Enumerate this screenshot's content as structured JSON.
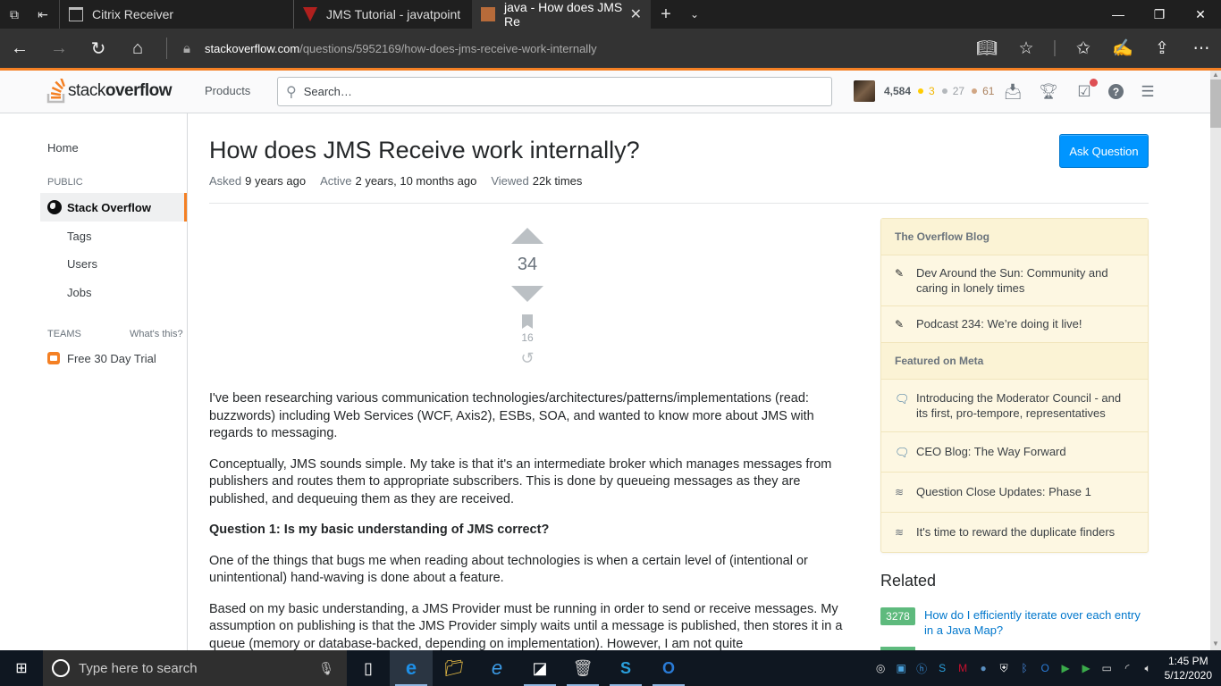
{
  "browser": {
    "tabs": [
      {
        "title": "Citrix Receiver",
        "icon": "window-icon",
        "active": false
      },
      {
        "title": "JMS Tutorial - javatpoint",
        "icon": "javatpoint-icon",
        "active": false
      },
      {
        "title": "java - How does JMS Re",
        "icon": "stackoverflow-icon",
        "active": true
      }
    ],
    "url_host": "stackoverflow.com",
    "url_path": "/questions/5952169/how-does-jms-receive-work-internally",
    "window_controls": {
      "minimize": "—",
      "restore": "❐",
      "close": "✕"
    }
  },
  "header": {
    "logo_light": "stack",
    "logo_bold": "overflow",
    "products": "Products",
    "search_placeholder": "Search…",
    "user": {
      "reputation": "4,584",
      "gold": "3",
      "silver": "27",
      "bronze": "61"
    }
  },
  "leftnav": {
    "home": "Home",
    "public_caption": "PUBLIC",
    "stack_overflow": "Stack Overflow",
    "tags": "Tags",
    "users": "Users",
    "jobs": "Jobs",
    "teams_caption": "TEAMS",
    "whats_this": "What's this?",
    "free_trial": "Free 30 Day Trial"
  },
  "question": {
    "title": "How does JMS Receive work internally?",
    "asked_label": "Asked",
    "asked_value": "9 years ago",
    "active_label": "Active",
    "active_value": "2 years, 10 months ago",
    "viewed_label": "Viewed",
    "viewed_value": "22k times",
    "ask_button": "Ask Question",
    "votes": "34",
    "bookmarks": "16",
    "body": [
      {
        "text": "I've been researching various communication technologies/architectures/patterns/implementations (read: buzzwords) including Web Services (WCF, Axis2), ESBs, SOA, and wanted to know more about JMS with regards to messaging.",
        "bold": false
      },
      {
        "text": "Conceptually, JMS sounds simple. My take is that it's an intermediate broker which manages messages from publishers and routes them to appropriate subscribers. This is done by queueing messages as they are published, and dequeuing them as they are received.",
        "bold": false
      },
      {
        "text": "Question 1: Is my basic understanding of JMS correct?",
        "bold": true
      },
      {
        "text": "One of the things that bugs me when reading about technologies is when a certain level of (intentional or unintentional) hand-waving is done about a feature.",
        "bold": false
      },
      {
        "text": "Based on my basic understanding, a JMS Provider must be running in order to send or receive messages. My assumption on publishing is that the JMS Provider simply waits until a message is published, then stores it in a queue (memory or database-backed, depending on implementation). However, I am not quite",
        "bold": false
      }
    ]
  },
  "sidebar": {
    "blog_header": "The Overflow Blog",
    "blog_items": [
      "Dev Around the Sun: Community and caring in lonely times",
      "Podcast 234: We’re doing it live!"
    ],
    "meta_header": "Featured on Meta",
    "meta_items": [
      {
        "text": "Introducing the Moderator Council - and its first, pro-tempore, representatives",
        "icon": "chat-bubble-icon"
      },
      {
        "text": "CEO Blog: The Way Forward",
        "icon": "chat-bubble-icon"
      },
      {
        "text": "Question Close Updates: Phase 1",
        "icon": "stack-exchange-icon"
      },
      {
        "text": "It's time to reward the duplicate finders",
        "icon": "stack-exchange-icon"
      }
    ],
    "related_title": "Related",
    "related": [
      {
        "score": "3278",
        "title": "How do I efficiently iterate over each entry in a Java Map?"
      }
    ]
  },
  "taskbar": {
    "search_placeholder": "Type here to search",
    "time": "1:45 PM",
    "date": "5/12/2020"
  },
  "colors": {
    "accent": "#f48024",
    "ask_button": "#0095ff",
    "link": "#0077cc",
    "related_score": "#5eba7d",
    "sidebar_bg": "#fdf7e2"
  }
}
